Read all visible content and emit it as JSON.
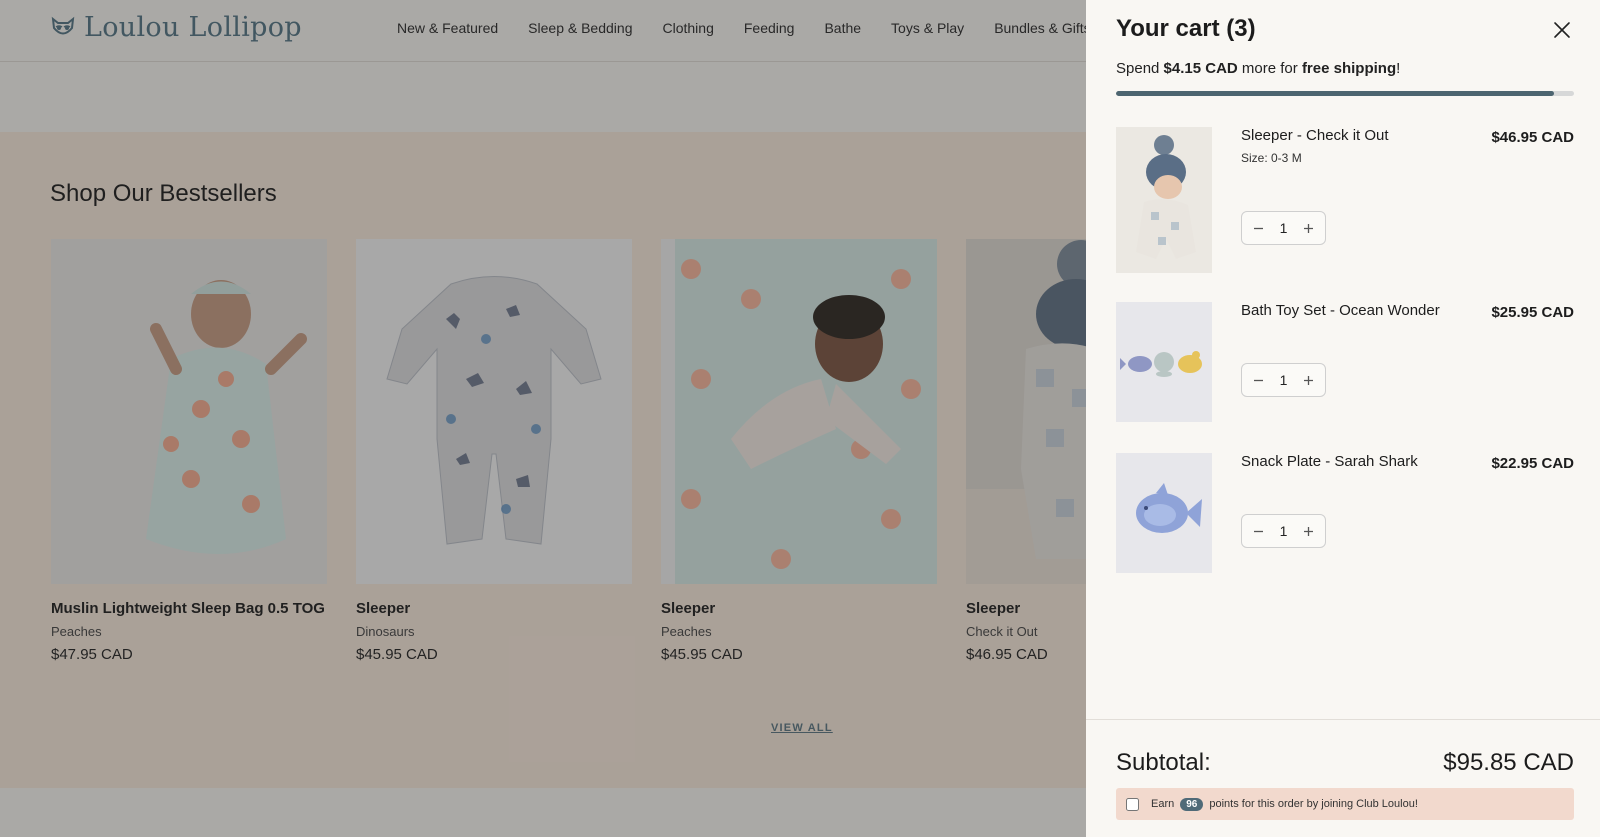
{
  "brand": {
    "name": "Loulou Lollipop"
  },
  "nav": [
    "New & Featured",
    "Sleep & Bedding",
    "Clothing",
    "Feeding",
    "Bathe",
    "Toys & Play",
    "Bundles & Gifts"
  ],
  "bestsellers": {
    "title": "Shop Our Bestsellers",
    "products": [
      {
        "name": "Muslin Lightweight Sleep Bag 0.5 TOG",
        "variant": "Peaches",
        "price": "$47.95 CAD"
      },
      {
        "name": "Sleeper",
        "variant": "Dinosaurs",
        "price": "$45.95 CAD"
      },
      {
        "name": "Sleeper",
        "variant": "Peaches",
        "price": "$45.95 CAD"
      },
      {
        "name": "Sleeper",
        "variant": "Check it Out",
        "price": "$46.95 CAD"
      }
    ],
    "view_all": "VIEW ALL"
  },
  "cart": {
    "title": "Your cart (3)",
    "shipping": {
      "prefix": "Spend ",
      "amount": "$4.15 CAD",
      "middle": " more for ",
      "goal": "free shipping",
      "suffix": "!",
      "progress": 0.956
    },
    "items": [
      {
        "title": "Sleeper - Check it Out",
        "size": "Size: 0-3 M",
        "price": "$46.95 CAD",
        "qty": "1",
        "image": "baby-in-hat-photo"
      },
      {
        "title": "Bath Toy Set - Ocean Wonder",
        "size": "",
        "price": "$25.95 CAD",
        "qty": "1",
        "image": "bath-toys-photo"
      },
      {
        "title": "Snack Plate - Sarah Shark",
        "size": "",
        "price": "$22.95 CAD",
        "qty": "1",
        "image": "shark-plate-photo"
      }
    ],
    "subtotal_label": "Subtotal:",
    "subtotal_value": "$95.85 CAD",
    "points": {
      "prefix": "Earn",
      "value": "96",
      "suffix": "points for this order by joining Club Loulou!"
    }
  },
  "colors": {
    "accent": "#4d6570",
    "bestsellers_bg": "#f5e6d8",
    "drawer_bg": "#f9f7f3",
    "points_bg": "#f2d9cd"
  }
}
